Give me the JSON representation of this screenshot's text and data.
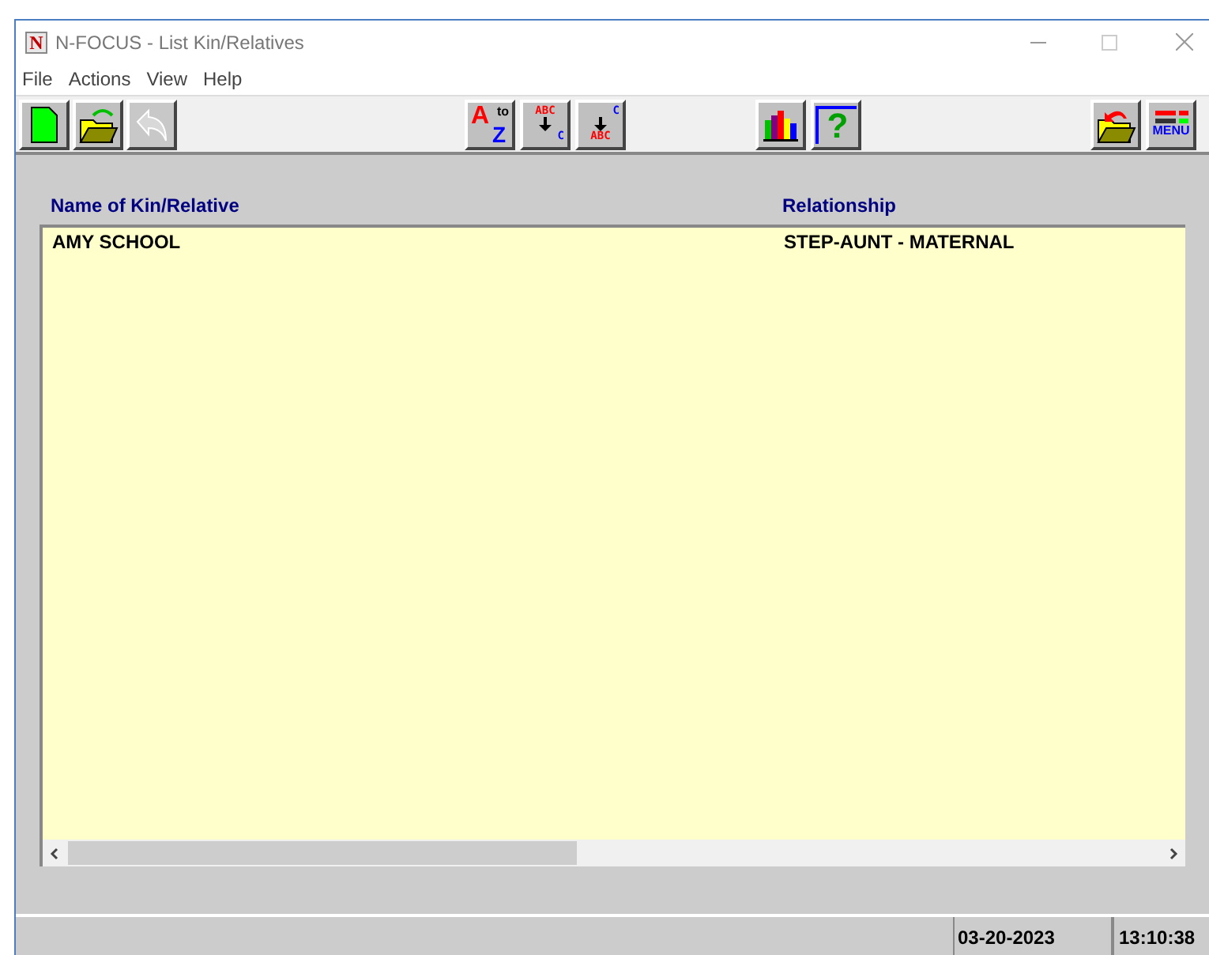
{
  "window": {
    "title": "N-FOCUS - List Kin/Relatives",
    "logo": "N"
  },
  "menu": [
    "File",
    "Actions",
    "View",
    "Help"
  ],
  "toolbar": [
    [
      {
        "kind": "new"
      },
      {
        "kind": "open"
      },
      {
        "kind": "undo",
        "disabled": true
      }
    ],
    [
      {
        "kind": "sort",
        "glyphs": [
          "A",
          "to",
          "Z"
        ]
      },
      {
        "kind": "down",
        "glyphs": [
          "ABC",
          "C"
        ]
      },
      {
        "kind": "up",
        "glyphs": [
          "C",
          "ABC"
        ]
      }
    ],
    [
      {
        "kind": "chart"
      },
      {
        "kind": "help",
        "glyphs": [
          "?"
        ]
      }
    ],
    [
      {
        "kind": "back"
      },
      {
        "kind": "menu",
        "glyphs": [
          "MENU"
        ]
      }
    ]
  ],
  "table": {
    "columns": [
      "Name of Kin/Relative",
      "Relationship"
    ],
    "rows": [
      [
        "AMY SCHOOL",
        "STEP-AUNT - MATERNAL"
      ]
    ]
  },
  "status_bar": {
    "date": "03-20-2023",
    "time": "13:10:38"
  }
}
